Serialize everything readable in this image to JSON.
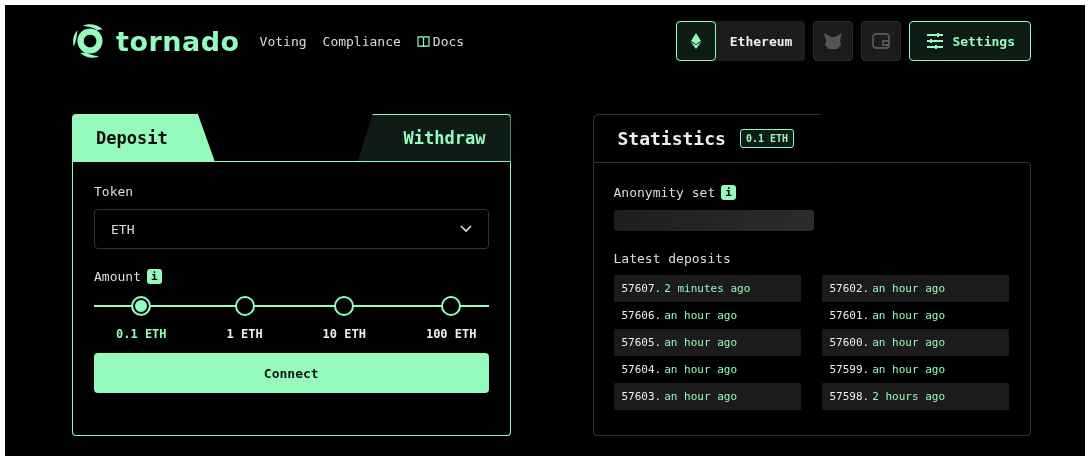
{
  "header": {
    "logo": "tornado",
    "nav": [
      {
        "label": "Voting",
        "kind": "link"
      },
      {
        "label": "Compliance",
        "kind": "link"
      },
      {
        "label": "Docs",
        "kind": "docs"
      }
    ],
    "network": {
      "label": "Ethereum"
    },
    "settings": {
      "label": "Settings"
    }
  },
  "tabs": [
    {
      "label": "Deposit",
      "selected": true
    },
    {
      "label": "Withdraw",
      "selected": false
    }
  ],
  "token": {
    "label": "Token",
    "value": "ETH"
  },
  "amount": {
    "label": "Amount",
    "info": "i",
    "options": [
      {
        "label": "0.1 ETH",
        "selected": true
      },
      {
        "label": "1 ETH",
        "selected": false
      },
      {
        "label": "10 ETH",
        "selected": false
      },
      {
        "label": "100 ETH",
        "selected": false
      }
    ]
  },
  "connect_button": "Connect",
  "statistics": {
    "title": "Statistics",
    "badge": "0.1 ETH",
    "anonymity_label": "Anonymity set",
    "info": "i",
    "latest_label": "Latest deposits",
    "columns": [
      [
        {
          "number": "57607.",
          "time": "2 minutes ago"
        },
        {
          "number": "57606.",
          "time": "an hour ago"
        },
        {
          "number": "57605.",
          "time": "an hour ago"
        },
        {
          "number": "57604.",
          "time": "an hour ago"
        },
        {
          "number": "57603.",
          "time": "an hour ago"
        }
      ],
      [
        {
          "number": "57602.",
          "time": "an hour ago"
        },
        {
          "number": "57601.",
          "time": "an hour ago"
        },
        {
          "number": "57600.",
          "time": "an hour ago"
        },
        {
          "number": "57599.",
          "time": "an hour ago"
        },
        {
          "number": "57598.",
          "time": "2 hours ago"
        }
      ]
    ]
  }
}
